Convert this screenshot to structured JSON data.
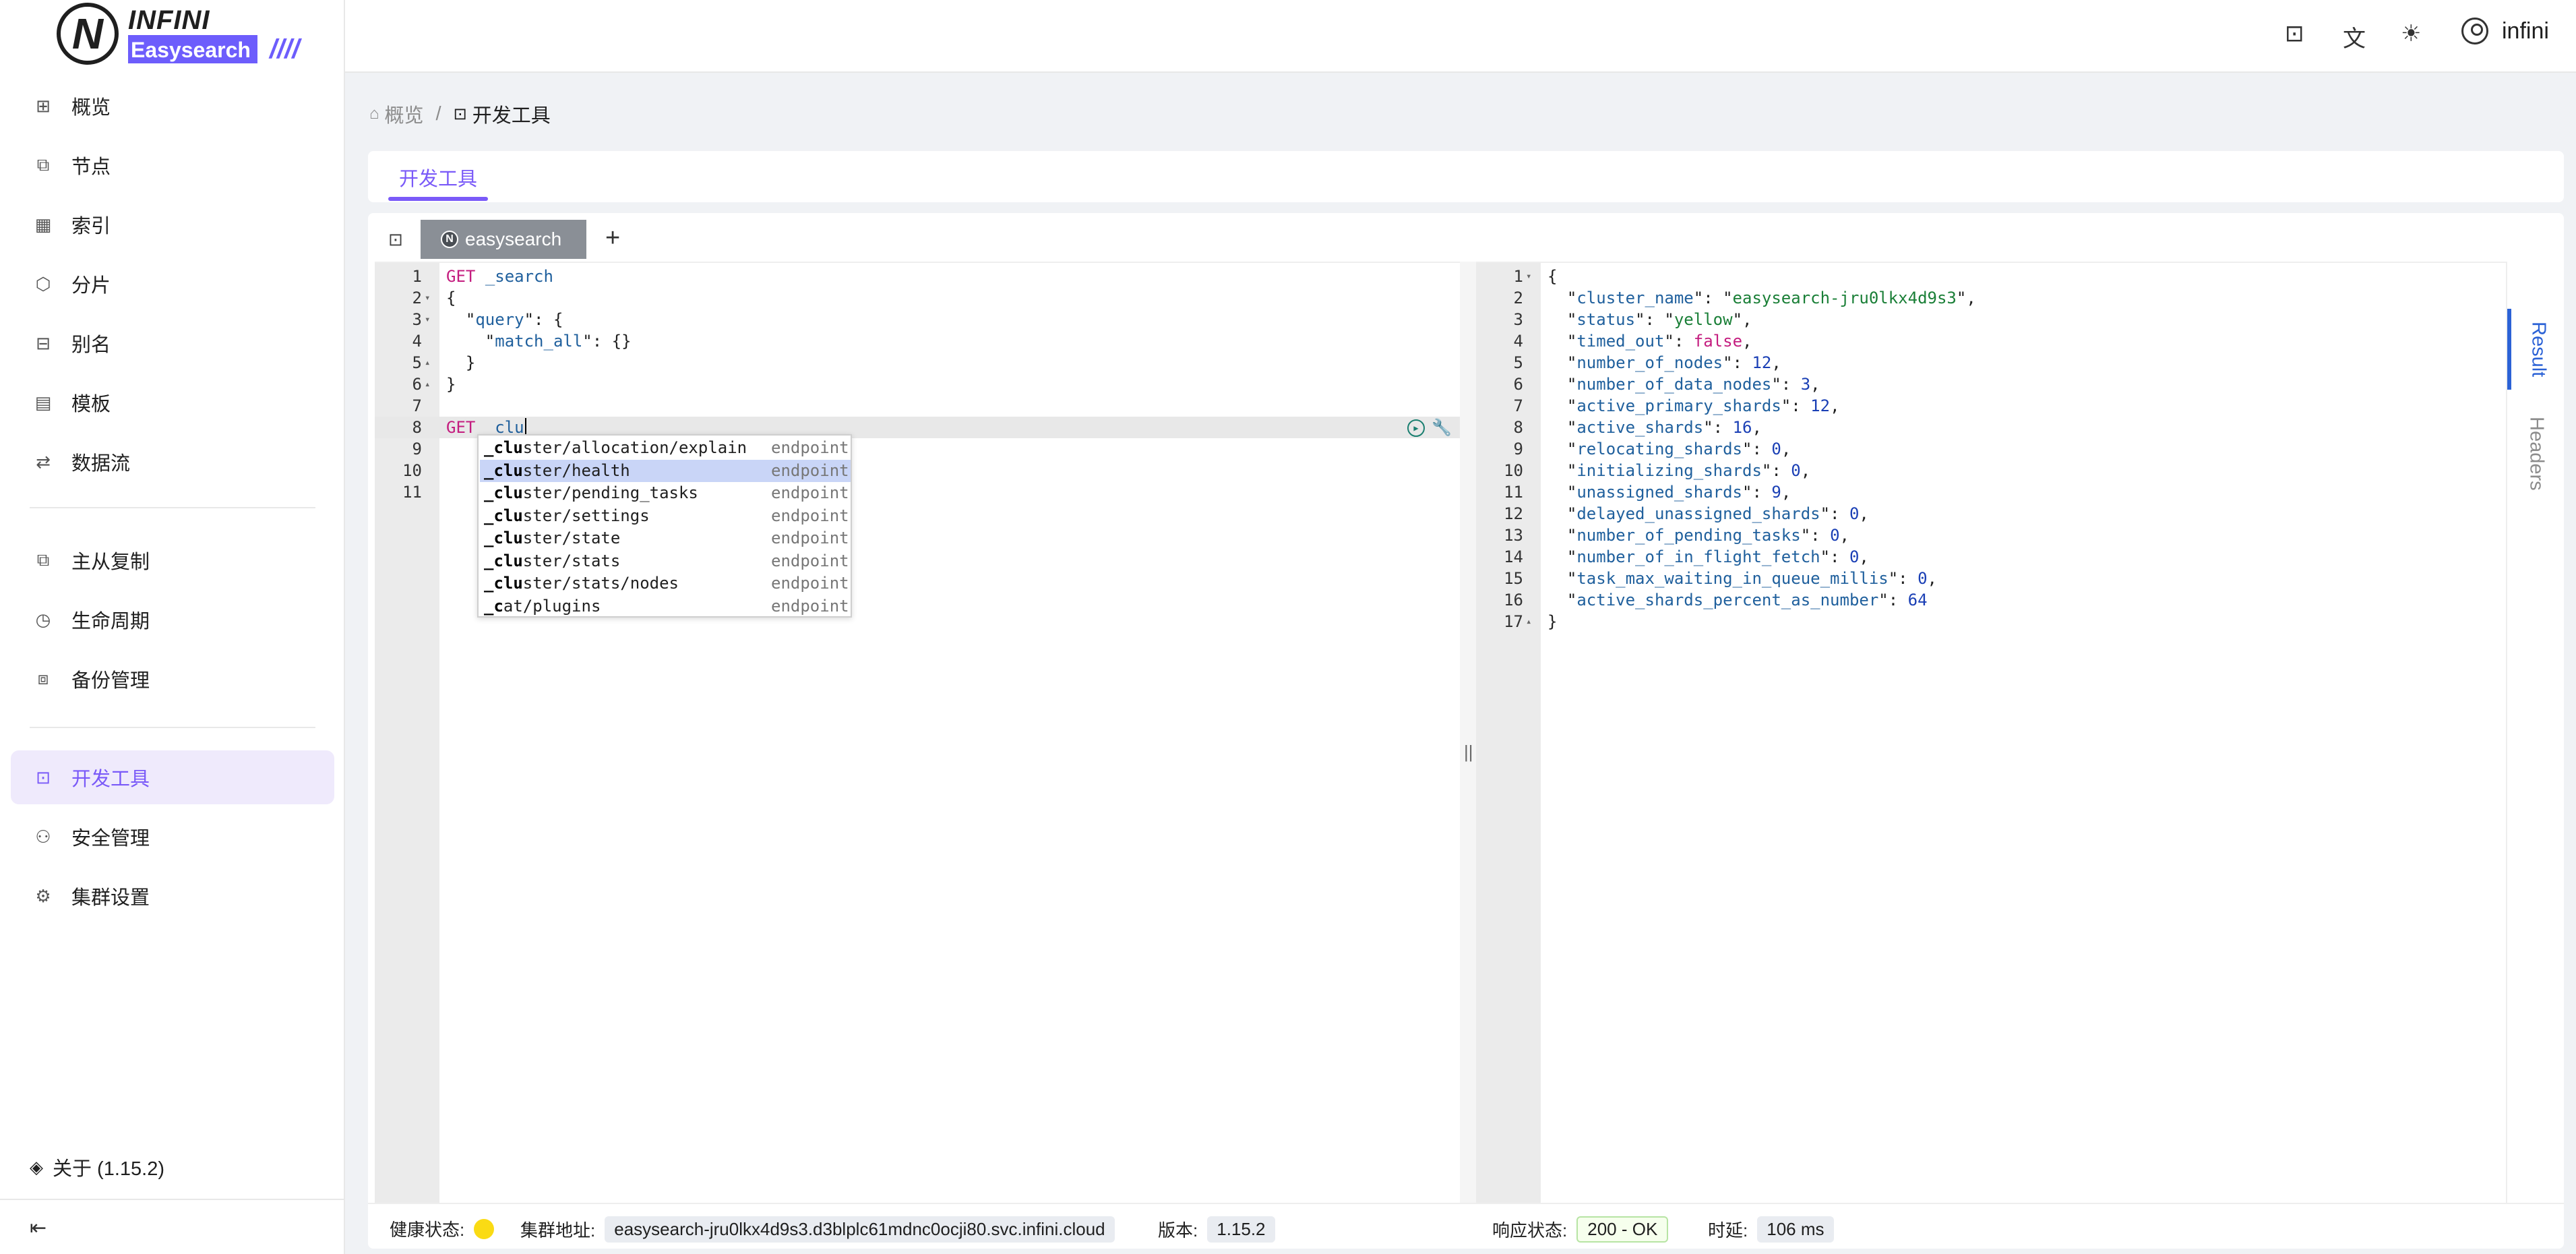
{
  "brand": {
    "mark": "N",
    "word": "INFINI",
    "product": "Easysearch",
    "slashes": "////"
  },
  "sidebar": {
    "items": [
      {
        "label": "概览",
        "icon": "dashboard-icon"
      },
      {
        "label": "节点",
        "icon": "nodes-icon"
      },
      {
        "label": "索引",
        "icon": "table-icon"
      },
      {
        "label": "分片",
        "icon": "shard-icon"
      },
      {
        "label": "别名",
        "icon": "alias-icon"
      },
      {
        "label": "模板",
        "icon": "template-icon"
      },
      {
        "label": "数据流",
        "icon": "stream-icon"
      },
      {
        "label": "主从复制",
        "icon": "copy-icon"
      },
      {
        "label": "生命周期",
        "icon": "clock-icon"
      },
      {
        "label": "备份管理",
        "icon": "backup-icon"
      },
      {
        "label": "开发工具",
        "icon": "terminal-icon",
        "active": true
      },
      {
        "label": "安全管理",
        "icon": "users-icon"
      },
      {
        "label": "集群设置",
        "icon": "gear-icon"
      }
    ],
    "about": "关于 (1.15.2)"
  },
  "header": {
    "user": "infini"
  },
  "breadcrumb": {
    "home": "概览",
    "current": "开发工具",
    "sep": "/"
  },
  "page_tab": "开发工具",
  "console": {
    "tab": "easysearch",
    "add": "+",
    "request_lines": [
      "GET _search",
      "{",
      "  \"query\": {",
      "    \"match_all\": {}",
      "  }",
      "}",
      "",
      "GET _clu",
      "",
      "",
      ""
    ],
    "autocomplete": [
      {
        "typed": "_clu",
        "rest": "ster/allocation/explain",
        "meta": "endpoint"
      },
      {
        "typed": "_clu",
        "rest": "ster/health",
        "meta": "endpoint",
        "selected": true
      },
      {
        "typed": "_clu",
        "rest": "ster/pending_tasks",
        "meta": "endpoint"
      },
      {
        "typed": "_clu",
        "rest": "ster/settings",
        "meta": "endpoint"
      },
      {
        "typed": "_clu",
        "rest": "ster/state",
        "meta": "endpoint"
      },
      {
        "typed": "_clu",
        "rest": "ster/stats",
        "meta": "endpoint"
      },
      {
        "typed": "_clu",
        "rest": "ster/stats/nodes",
        "meta": "endpoint"
      },
      {
        "typed": "_c",
        "rest": "at/plugins",
        "meta": "endpoint"
      }
    ],
    "response": {
      "cluster_name": "easysearch-jru0lkx4d9s3",
      "status": "yellow",
      "timed_out": "false",
      "number_of_nodes": "12",
      "number_of_data_nodes": "3",
      "active_primary_shards": "12",
      "active_shards": "16",
      "relocating_shards": "0",
      "initializing_shards": "0",
      "unassigned_shards": "9",
      "delayed_unassigned_shards": "0",
      "number_of_pending_tasks": "0",
      "number_of_in_flight_fetch": "0",
      "task_max_waiting_in_queue_millis": "0",
      "active_shards_percent_as_number": "64"
    },
    "side_tabs": {
      "result": "Result",
      "headers": "Headers"
    }
  },
  "status": {
    "health_label": "健康状态:",
    "health_color": "#fadb14",
    "address_label": "集群地址:",
    "address": "easysearch-jru0lkx4d9s3.d3blplc61mdnc0ocji80.svc.infini.cloud",
    "version_label": "版本:",
    "version": "1.15.2",
    "response_label": "响应状态:",
    "response": "200 - OK",
    "latency_label": "时延:",
    "latency": "106 ms"
  },
  "colors": {
    "accent": "#7a5af8",
    "link_blue": "#2b62d6"
  }
}
